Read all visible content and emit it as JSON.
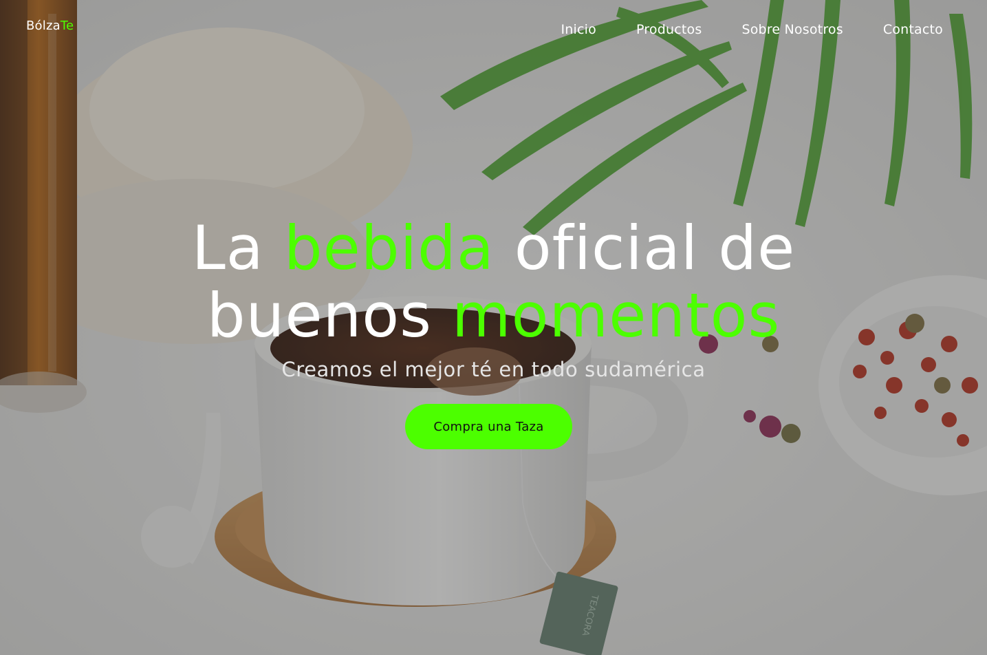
{
  "brand": {
    "name_part1": "Bólza",
    "name_part2": "Te"
  },
  "nav": {
    "items": [
      {
        "label": "Inicio"
      },
      {
        "label": "Productos"
      },
      {
        "label": "Sobre Nosotros"
      },
      {
        "label": "Contacto"
      }
    ]
  },
  "hero": {
    "headline": {
      "w1": "La",
      "w2": "bebida",
      "w3": "oficial de",
      "w4": "buenos",
      "w5": "momentos"
    },
    "subtitle": "Creamos el mejor té en todo sudamérica",
    "cta_label": "Compra una Taza",
    "tea_tag_text": "TEACORA"
  },
  "colors": {
    "accent": "#4cff00",
    "text": "#ffffff",
    "overlay": "rgba(70,70,68,0.42)"
  }
}
